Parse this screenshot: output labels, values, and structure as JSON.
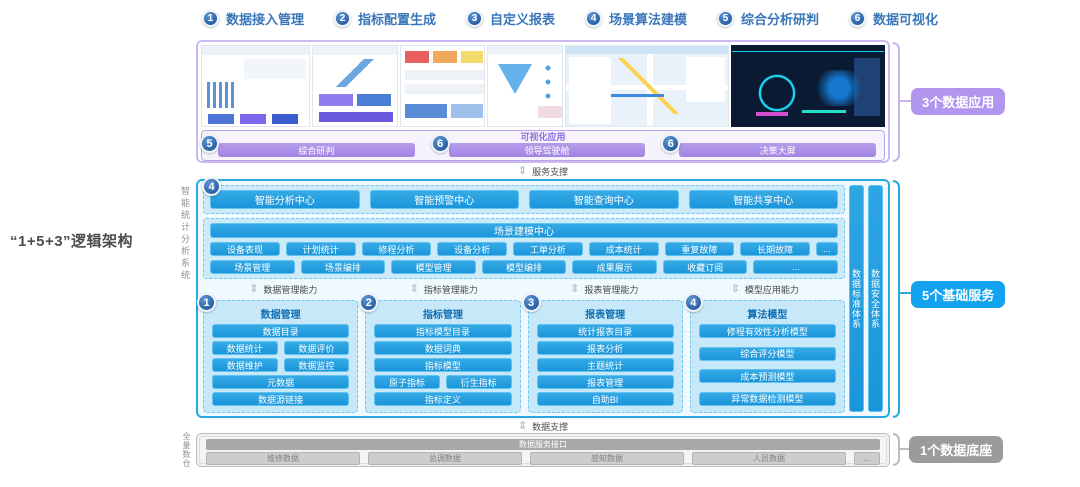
{
  "page": {
    "left_title": "“1+5+3”逻辑架构"
  },
  "nav": {
    "items": [
      {
        "num": "1",
        "label": "数据接入管理"
      },
      {
        "num": "2",
        "label": "指标配置生成"
      },
      {
        "num": "3",
        "label": "自定义报表"
      },
      {
        "num": "4",
        "label": "场景算法建模"
      },
      {
        "num": "5",
        "label": "综合分析研判"
      },
      {
        "num": "6",
        "label": "数据可视化"
      }
    ]
  },
  "right_badges": {
    "apps": "3个数据应用",
    "services": "5个基础服务",
    "base": "1个数据底座"
  },
  "app_layer": {
    "thumbnails": [
      "bi-analytics-dashboard",
      "kpi-charts-dashboard",
      "report-cards-dashboard",
      "funnel-dashboard",
      "gis-map-dashboard",
      "dark-bigscreen-dashboard"
    ],
    "viz_title": "可视化应用",
    "bars": [
      {
        "num": "5",
        "label": "综合研判"
      },
      {
        "num": "6",
        "label": "领导驾驶舱"
      },
      {
        "num": "6",
        "label": "决策大屏"
      }
    ]
  },
  "dividers": {
    "service": "服务支撑",
    "data": "数据支撑"
  },
  "service_layer": {
    "badge": "4",
    "system_label": "智能统计分析系统",
    "centers": [
      "智能分析中心",
      "智能预警中心",
      "智能查询中心",
      "智能共享中心"
    ],
    "scene": {
      "title": "场景建模中心",
      "row1": [
        "设备表现",
        "计划统计",
        "修程分析",
        "设备分析",
        "工单分析",
        "成本统计",
        "重复故障",
        "长期故障",
        "..."
      ],
      "row2": [
        "场景管理",
        "场景编排",
        "模型管理",
        "模型编排",
        "成果展示",
        "收藏订阅",
        "..."
      ]
    },
    "capabilities": [
      "数据管理能力",
      "指标管理能力",
      "报表管理能力",
      "模型应用能力"
    ],
    "groups": [
      {
        "num": "1",
        "title": "数据管理",
        "rows": [
          [
            "数据目录"
          ],
          [
            "数据统计",
            "数据评价"
          ],
          [
            "数据维护",
            "数据监控"
          ],
          [
            "元数据"
          ],
          [
            "数据源链接"
          ]
        ]
      },
      {
        "num": "2",
        "title": "指标管理",
        "rows": [
          [
            "指标模型目录"
          ],
          [
            "数据词典"
          ],
          [
            "指标模型"
          ],
          [
            "原子指标",
            "衍生指标"
          ],
          [
            "指标定义"
          ]
        ]
      },
      {
        "num": "3",
        "title": "报表管理",
        "rows": [
          [
            "统计报表目录"
          ],
          [
            "报表分析"
          ],
          [
            "主题统计"
          ],
          [
            "报表管理"
          ],
          [
            "自助BI"
          ]
        ]
      },
      {
        "num": "4",
        "title": "算法模型",
        "rows": [
          [
            "修程有效性分析模型"
          ],
          [
            "综合评分模型"
          ],
          [
            "成本预测模型"
          ],
          [
            "异常数据检测模型"
          ]
        ]
      }
    ],
    "pillars": [
      "数据标准体系",
      "数据安全体系"
    ]
  },
  "data_layer": {
    "warehouse_label": "全量数仓",
    "header": "数据服务接口",
    "items": [
      "维修数据",
      "总调数据",
      "感知数据",
      "人员数据",
      "..."
    ]
  }
}
